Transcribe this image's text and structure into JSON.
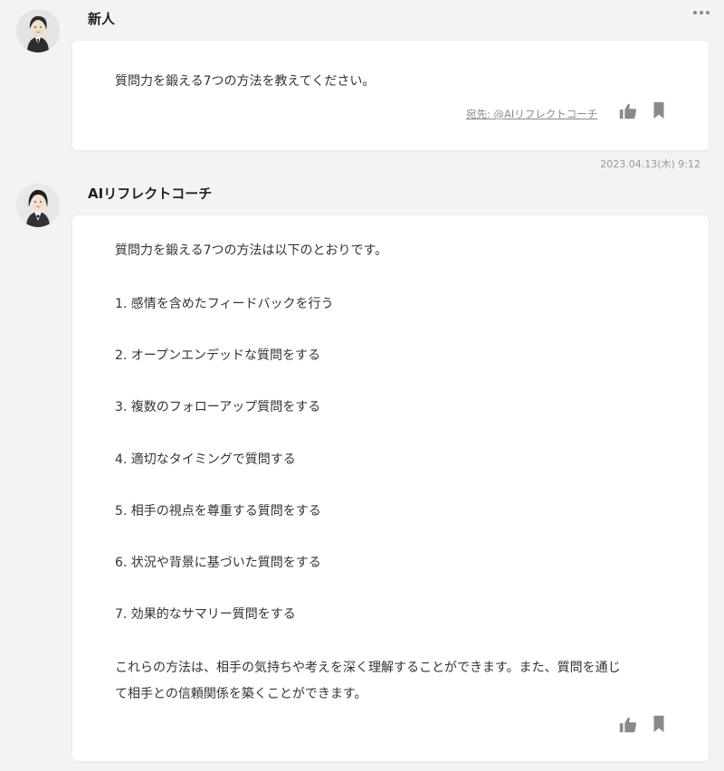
{
  "thread": {
    "messages": [
      {
        "sender": "新人",
        "text": "質問力を鍛える7つの方法を教えてください。",
        "addressee": "宛先: @AIリフレクトコーチ",
        "timestamp": "2023.04.13(木) 9:12",
        "icons": [
          "thumbs-up-icon",
          "bookmark-icon",
          "more-icon"
        ]
      },
      {
        "sender": "AIリフレクトコーチ",
        "intro": "質問力を鍛える7つの方法は以下のとおりです。",
        "items": [
          "1. 感情を含めたフィードバックを行う",
          "2. オープンエンデッドな質問をする",
          "3. 複数のフォローアップ質問をする",
          "4. 適切なタイミングで質問する",
          "5. 相手の視点を尊重する質問をする",
          "6. 状況や背景に基づいた質問をする",
          "7. 効果的なサマリー質問をする"
        ],
        "closing_line1": "これらの方法は、相手の気持ちや考えを深く理解することができます。また、質問を通じ",
        "closing_line2": "て相手との信頼関係を築くことができます。",
        "icons": [
          "thumbs-up-icon",
          "bookmark-icon"
        ]
      }
    ]
  },
  "colors": {
    "background": "#f3f3f3",
    "card": "#ffffff",
    "icon": "#8a8a8a"
  }
}
